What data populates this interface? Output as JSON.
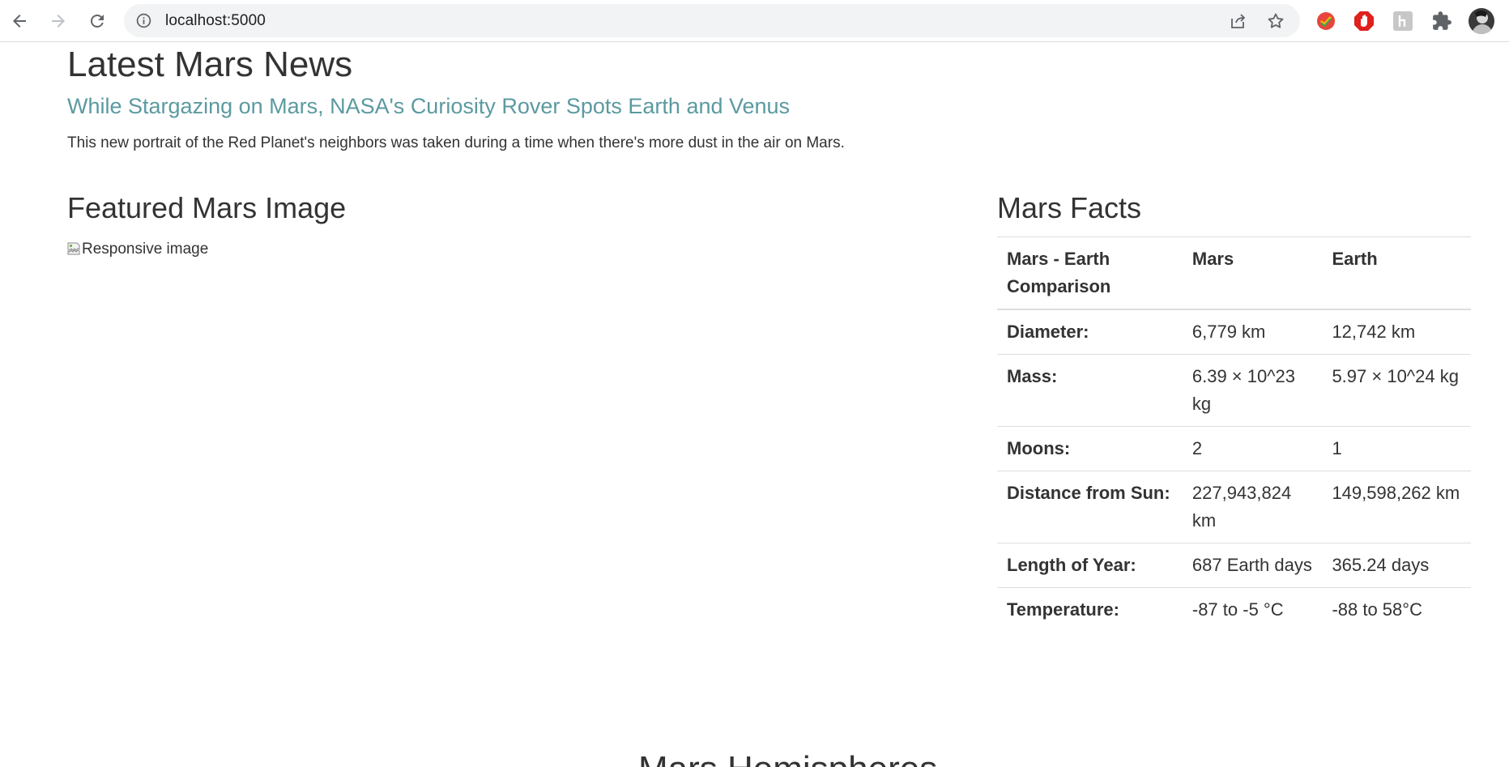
{
  "browser": {
    "url": "localhost:5000"
  },
  "news": {
    "section_title": "Latest Mars News",
    "headline": "While Stargazing on Mars, NASA's Curiosity Rover Spots Earth and Venus",
    "teaser": "This new portrait of the Red Planet's neighbors was taken during a time when there's more dust in the air on Mars."
  },
  "featured": {
    "section_title": "Featured Mars Image",
    "image_alt": "Responsive image"
  },
  "facts": {
    "section_title": "Mars Facts",
    "headers": [
      "Mars - Earth Comparison",
      "Mars",
      "Earth"
    ],
    "rows": [
      [
        "Diameter:",
        "6,779 km",
        "12,742 km"
      ],
      [
        "Mass:",
        "6.39 × 10^23 kg",
        "5.97 × 10^24 kg"
      ],
      [
        "Moons:",
        "2",
        "1"
      ],
      [
        "Distance from Sun:",
        "227,943,824 km",
        "149,598,262 km"
      ],
      [
        "Length of Year:",
        "687 Earth days",
        "365.24 days"
      ],
      [
        "Temperature:",
        "-87 to -5 °C",
        "-88 to 58°C"
      ]
    ]
  },
  "hemispheres": {
    "section_title": "Mars Hemispheres"
  }
}
